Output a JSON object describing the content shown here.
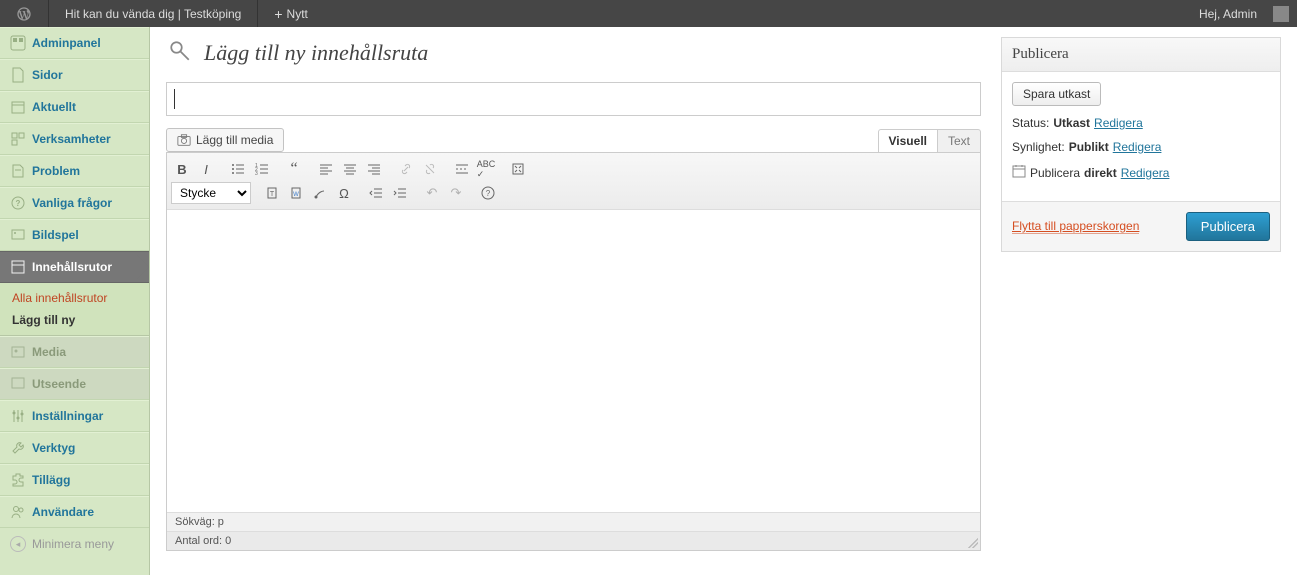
{
  "adminbar": {
    "site_title": "Hit kan du vända dig | Testköping",
    "new_label": "Nytt",
    "greeting": "Hej, Admin"
  },
  "sidebar": {
    "items": [
      {
        "label": "Adminpanel"
      },
      {
        "label": "Sidor"
      },
      {
        "label": "Aktuellt"
      },
      {
        "label": "Verksamheter"
      },
      {
        "label": "Problem"
      },
      {
        "label": "Vanliga frågor"
      },
      {
        "label": "Bildspel"
      },
      {
        "label": "Innehållsrutor"
      },
      {
        "label": "Media"
      },
      {
        "label": "Utseende"
      },
      {
        "label": "Inställningar"
      },
      {
        "label": "Verktyg"
      },
      {
        "label": "Tillägg"
      },
      {
        "label": "Användare"
      }
    ],
    "submenu": {
      "all": "Alla innehållsrutor",
      "add": "Lägg till ny"
    },
    "collapse": "Minimera meny"
  },
  "page": {
    "heading": "Lägg till ny innehållsruta",
    "title_value": "",
    "media_button": "Lägg till media",
    "tab_visual": "Visuell",
    "tab_text": "Text",
    "format_select": "Stycke",
    "status_path": "Sökväg: p",
    "word_count": "Antal ord: 0"
  },
  "publish": {
    "box_title": "Publicera",
    "save_draft": "Spara utkast",
    "status_label": "Status:",
    "status_value": "Utkast",
    "visibility_label": "Synlighet:",
    "visibility_value": "Publikt",
    "schedule_label": "Publicera",
    "schedule_value": "direkt",
    "edit": "Redigera",
    "trash": "Flytta till papperskorgen",
    "publish_btn": "Publicera"
  }
}
